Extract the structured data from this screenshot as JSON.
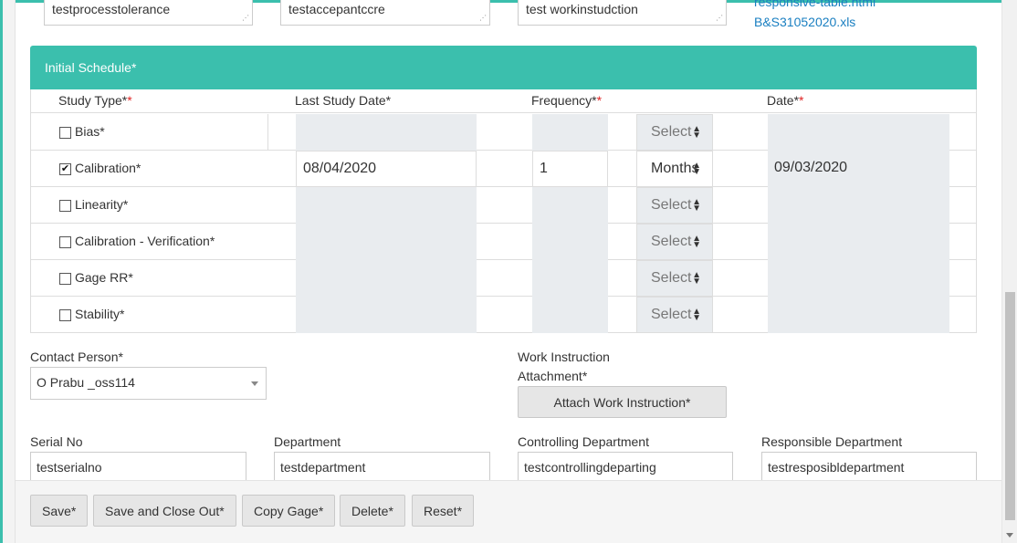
{
  "top_fields": {
    "process_tolerance": "testprocesstolerance",
    "acceptance_criteria": "testaccepantccre",
    "work_instruction": "test workinstudction",
    "link_1": "responsive-table.html",
    "link_2": "B&S31052020.xls"
  },
  "schedule": {
    "title": "Initial Schedule*",
    "headers": {
      "study_type": "Study Type*",
      "study_type_req": "*",
      "last_study_date": "Last Study Date*",
      "frequency": "Frequency*",
      "frequency_req": "*",
      "date": "Date*",
      "date_req": "*"
    },
    "rows": [
      {
        "label": "Bias*",
        "checked": false,
        "check_mark": "",
        "last_study_date": "",
        "frequency": "",
        "unit": "Select",
        "date": ""
      },
      {
        "label": "Calibration*",
        "checked": true,
        "check_mark": "✔",
        "last_study_date": "08/04/2020",
        "frequency": "1",
        "unit": "Months",
        "date": "09/03/2020"
      },
      {
        "label": "Linearity*",
        "checked": false,
        "check_mark": "",
        "last_study_date": "",
        "frequency": "",
        "unit": "Select",
        "date": ""
      },
      {
        "label": "Calibration - Verification*",
        "checked": false,
        "check_mark": "",
        "last_study_date": "",
        "frequency": "",
        "unit": "Select",
        "date": ""
      },
      {
        "label": "Gage RR*",
        "checked": false,
        "check_mark": "",
        "last_study_date": "",
        "frequency": "",
        "unit": "Select",
        "date": ""
      },
      {
        "label": "Stability*",
        "checked": false,
        "check_mark": "",
        "last_study_date": "",
        "frequency": "",
        "unit": "Select",
        "date": ""
      }
    ]
  },
  "contact": {
    "label": "Contact Person*",
    "value": "O Prabu _oss114"
  },
  "work_instruction": {
    "label_line1": "Work Instruction",
    "label_line2": "Attachment*",
    "button": "Attach Work Instruction*"
  },
  "details": {
    "serial_label": "Serial No",
    "serial_value": "testserialno",
    "dept_label": "Department",
    "dept_value": "testdepartment",
    "ctrl_dept_label": "Controlling Department",
    "ctrl_dept_value": "testcontrollingdeparting",
    "resp_dept_label": "Responsible Department",
    "resp_dept_value": "testresposibldepartment"
  },
  "footer": {
    "save": "Save*",
    "save_close": "Save and Close Out*",
    "copy": "Copy Gage*",
    "delete": "Delete*",
    "reset": "Reset*"
  },
  "colors": {
    "accent": "#3bbfad",
    "required": "#e02424",
    "link": "#1a7fc1"
  }
}
